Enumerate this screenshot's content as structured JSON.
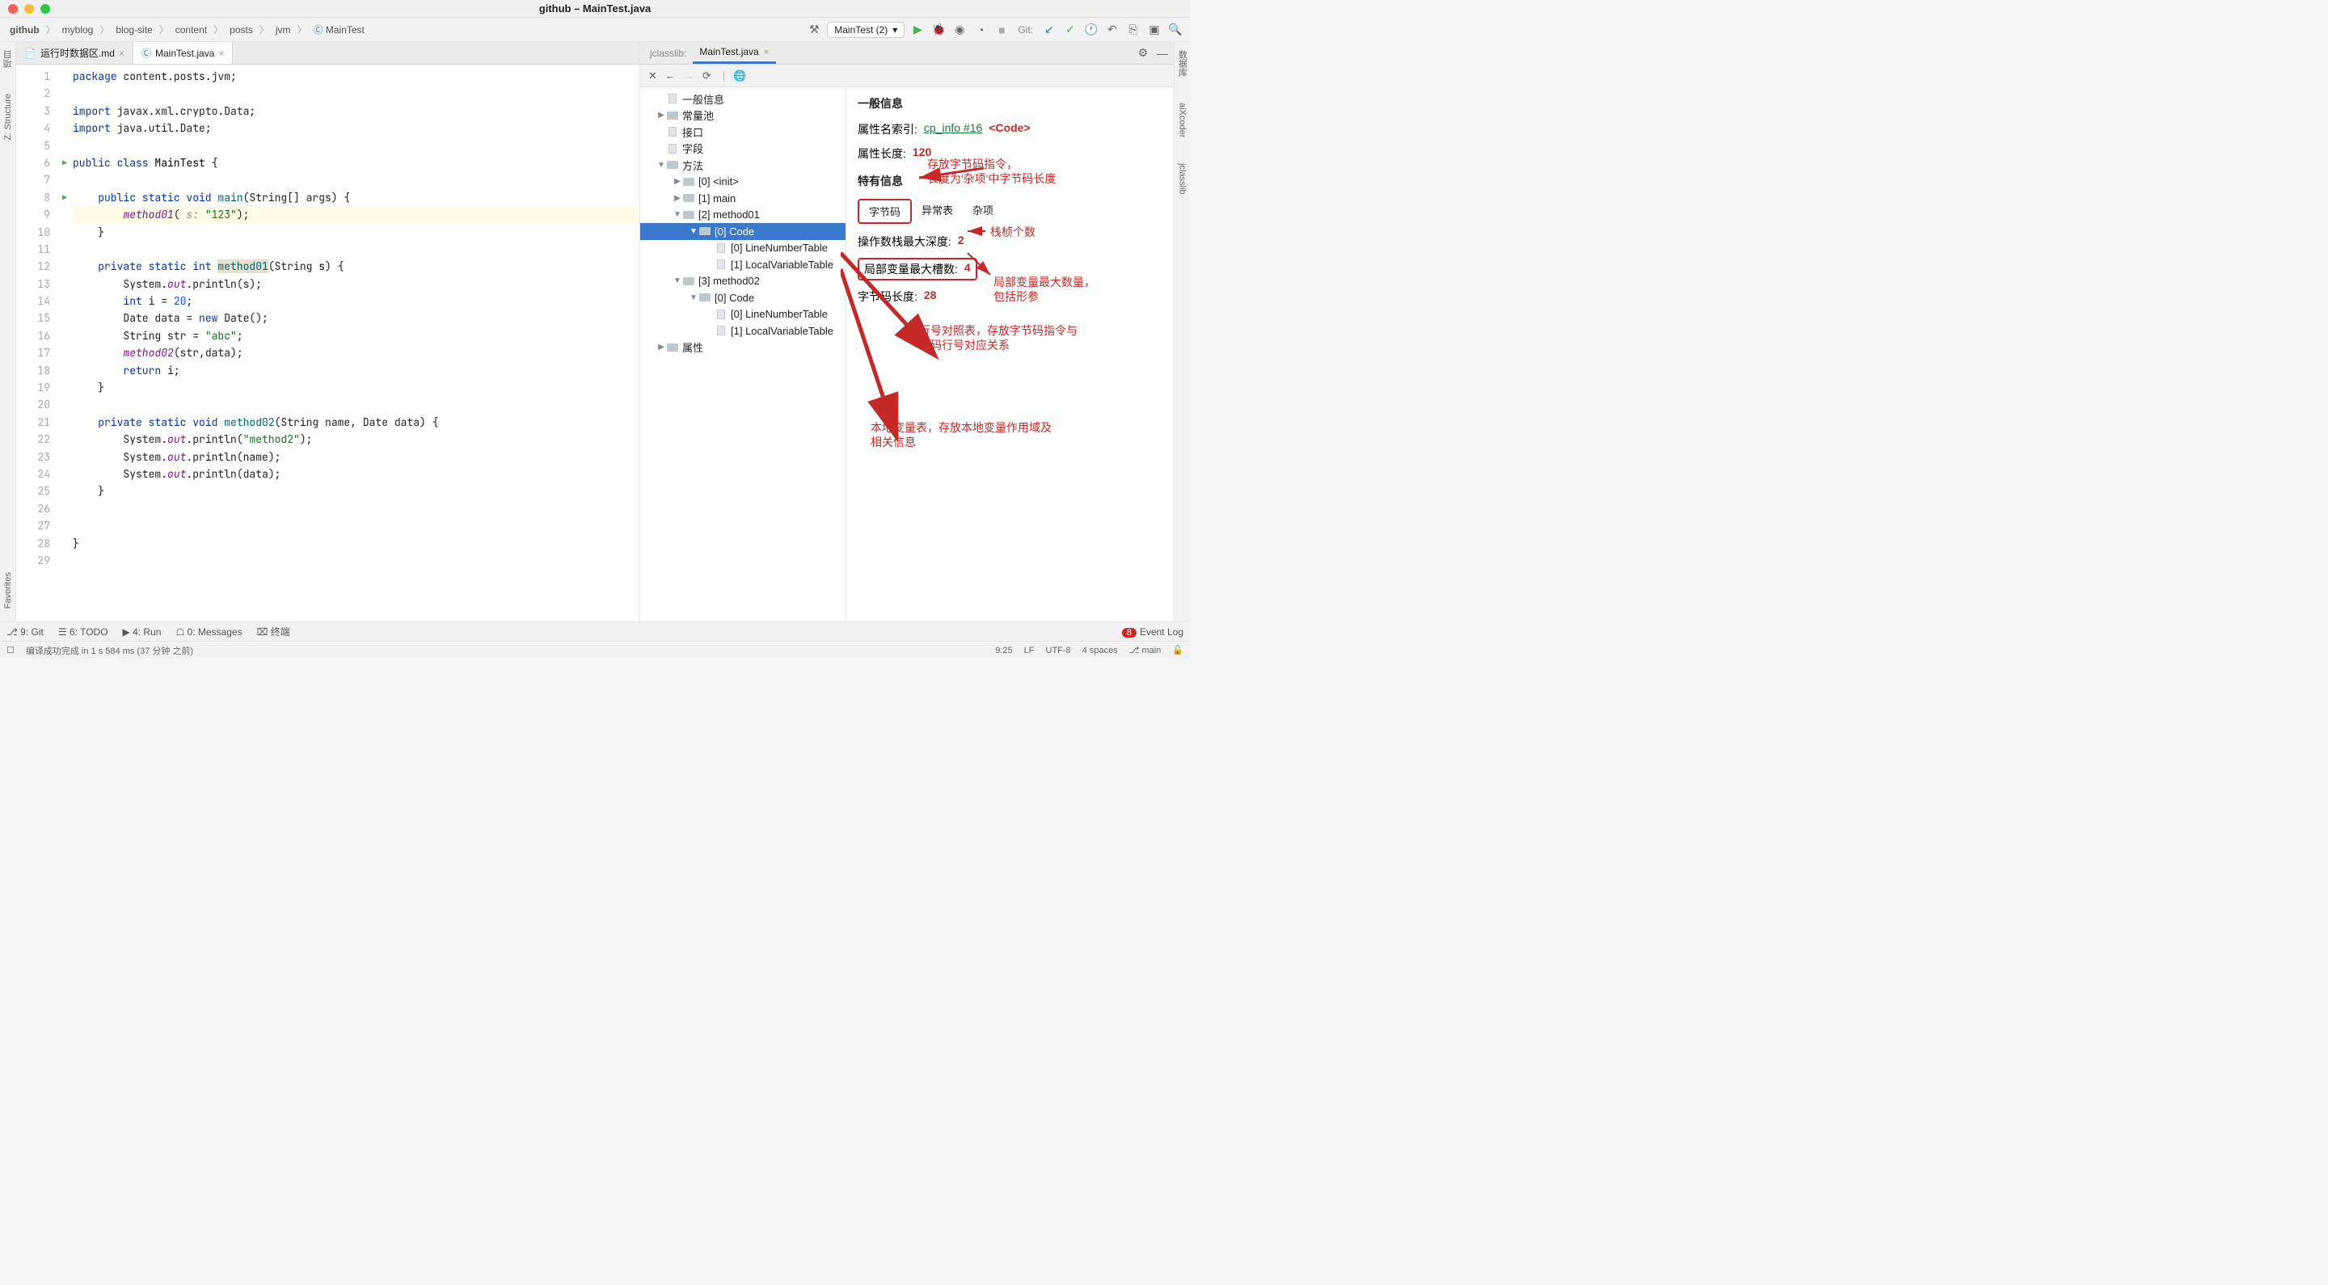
{
  "window_title": "github – MainTest.java",
  "breadcrumbs": [
    "github",
    "myblog",
    "blog-site",
    "content",
    "posts",
    "jvm",
    "MainTest"
  ],
  "run_config": "MainTest (2)",
  "git_label": "Git:",
  "editor_tabs": [
    {
      "label": "运行时数据区.md",
      "active": false,
      "icon": "md"
    },
    {
      "label": "MainTest.java",
      "active": true,
      "icon": "java"
    }
  ],
  "code_lines": [
    {
      "n": 1,
      "segs": [
        [
          "kw",
          "package"
        ],
        [
          "",
          " content.posts.jvm;"
        ]
      ]
    },
    {
      "n": 2,
      "segs": []
    },
    {
      "n": 3,
      "segs": [
        [
          "kw",
          "import"
        ],
        [
          "",
          " javax.xml.crypto.Data;"
        ]
      ]
    },
    {
      "n": 4,
      "segs": [
        [
          "kw",
          "import"
        ],
        [
          "",
          " java.util.Date;"
        ]
      ]
    },
    {
      "n": 5,
      "segs": []
    },
    {
      "n": 6,
      "marker": "▶",
      "segs": [
        [
          "kw",
          "public class "
        ],
        [
          "cls",
          "MainTest"
        ],
        [
          "",
          " {"
        ]
      ]
    },
    {
      "n": 7,
      "segs": []
    },
    {
      "n": 8,
      "marker": "▶",
      "segs": [
        [
          "",
          "    "
        ],
        [
          "kw",
          "public static void "
        ],
        [
          "mthdef",
          "main"
        ],
        [
          "",
          "(String[] args) {"
        ]
      ]
    },
    {
      "n": 9,
      "hl": true,
      "segs": [
        [
          "",
          "        "
        ],
        [
          "fld",
          "method01"
        ],
        [
          "",
          "( "
        ],
        [
          "comment",
          "s: "
        ],
        [
          "str",
          "\"123\""
        ],
        [
          "",
          ");"
        ]
      ]
    },
    {
      "n": 10,
      "segs": [
        [
          "",
          "    }"
        ]
      ]
    },
    {
      "n": 11,
      "segs": []
    },
    {
      "n": 12,
      "segs": [
        [
          "",
          "    "
        ],
        [
          "kw",
          "private static int "
        ],
        [
          "mthdef hl",
          "method01"
        ],
        [
          "",
          "(String "
        ],
        [
          "param",
          "s"
        ],
        [
          "",
          ") {"
        ]
      ]
    },
    {
      "n": 13,
      "segs": [
        [
          "",
          "        System."
        ],
        [
          "fld",
          "out"
        ],
        [
          "",
          ".println(s);"
        ]
      ]
    },
    {
      "n": 14,
      "segs": [
        [
          "",
          "        "
        ],
        [
          "kw",
          "int"
        ],
        [
          "",
          " i = "
        ],
        [
          "num",
          "20"
        ],
        [
          "",
          ";"
        ]
      ]
    },
    {
      "n": 15,
      "segs": [
        [
          "",
          "        Date data = "
        ],
        [
          "kw",
          "new"
        ],
        [
          "",
          " Date();"
        ]
      ]
    },
    {
      "n": 16,
      "segs": [
        [
          "",
          "        String str = "
        ],
        [
          "str",
          "\"abc\""
        ],
        [
          "",
          ";"
        ]
      ]
    },
    {
      "n": 17,
      "segs": [
        [
          "",
          "        "
        ],
        [
          "fld",
          "method02"
        ],
        [
          "",
          "(str,data);"
        ]
      ]
    },
    {
      "n": 18,
      "segs": [
        [
          "",
          "        "
        ],
        [
          "kw",
          "return"
        ],
        [
          "",
          " i;"
        ]
      ]
    },
    {
      "n": 19,
      "segs": [
        [
          "",
          "    }"
        ]
      ]
    },
    {
      "n": 20,
      "segs": []
    },
    {
      "n": 21,
      "segs": [
        [
          "",
          "    "
        ],
        [
          "kw",
          "private static void "
        ],
        [
          "mthdef",
          "method02"
        ],
        [
          "",
          "(String name, Date data) {"
        ]
      ]
    },
    {
      "n": 22,
      "segs": [
        [
          "",
          "        System."
        ],
        [
          "fld",
          "out"
        ],
        [
          "",
          ".println("
        ],
        [
          "str",
          "\"method2\""
        ],
        [
          "",
          ");"
        ]
      ]
    },
    {
      "n": 23,
      "segs": [
        [
          "",
          "        System."
        ],
        [
          "fld",
          "out"
        ],
        [
          "",
          ".println(name);"
        ]
      ]
    },
    {
      "n": 24,
      "segs": [
        [
          "",
          "        System."
        ],
        [
          "fld",
          "out"
        ],
        [
          "",
          ".println(data);"
        ]
      ]
    },
    {
      "n": 25,
      "segs": [
        [
          "",
          "    }"
        ]
      ]
    },
    {
      "n": 26,
      "segs": []
    },
    {
      "n": 27,
      "segs": []
    },
    {
      "n": 28,
      "segs": [
        [
          "",
          "}"
        ]
      ]
    },
    {
      "n": 29,
      "segs": []
    }
  ],
  "jclasslib_label": "jclasslib:",
  "jclasslib_tab": "MainTest.java",
  "jtree": [
    {
      "pad": 20,
      "arrow": "",
      "icon": "file",
      "label": "一般信息"
    },
    {
      "pad": 20,
      "arrow": "▶",
      "icon": "folder",
      "label": "常量池"
    },
    {
      "pad": 20,
      "arrow": "",
      "icon": "file",
      "label": "接口"
    },
    {
      "pad": 20,
      "arrow": "",
      "icon": "file",
      "label": "字段"
    },
    {
      "pad": 20,
      "arrow": "▼",
      "icon": "folder",
      "label": "方法"
    },
    {
      "pad": 40,
      "arrow": "▶",
      "icon": "folder",
      "label": "[0] <init>"
    },
    {
      "pad": 40,
      "arrow": "▶",
      "icon": "folder",
      "label": "[1] main"
    },
    {
      "pad": 40,
      "arrow": "▼",
      "icon": "folder",
      "label": "[2] method01"
    },
    {
      "pad": 60,
      "arrow": "▼",
      "icon": "folder",
      "label": "[0] Code",
      "sel": true
    },
    {
      "pad": 80,
      "arrow": "",
      "icon": "file",
      "label": "[0] LineNumberTable"
    },
    {
      "pad": 80,
      "arrow": "",
      "icon": "file",
      "label": "[1] LocalVariableTable"
    },
    {
      "pad": 40,
      "arrow": "▼",
      "icon": "folder",
      "label": "[3] method02"
    },
    {
      "pad": 60,
      "arrow": "▼",
      "icon": "folder",
      "label": "[0] Code"
    },
    {
      "pad": 80,
      "arrow": "",
      "icon": "file",
      "label": "[0] LineNumberTable"
    },
    {
      "pad": 80,
      "arrow": "",
      "icon": "file",
      "label": "[1] LocalVariableTable"
    },
    {
      "pad": 20,
      "arrow": "▶",
      "icon": "folder",
      "label": "属性"
    }
  ],
  "detail": {
    "section1": "一般信息",
    "attr_name_label": "属性名索引:",
    "attr_name_link": "cp_info #16",
    "attr_name_extra": "<Code>",
    "attr_len_label": "属性长度:",
    "attr_len_val": "120",
    "section2": "特有信息",
    "tabs2": [
      "字节码",
      "异常表",
      "杂项"
    ],
    "max_stack_label": "操作数栈最大深度:",
    "max_stack_val": "2",
    "max_locals_label": "局部变量最大槽数:",
    "max_locals_val": "4",
    "code_len_label": "字节码长度:",
    "code_len_val": "28"
  },
  "annotations": {
    "a1": "存放字节码指令，\n长度为'杂项'中字节码长度",
    "a2": "栈桢个数",
    "a3": "局部变量最大数量，\n包括形参",
    "a4": "行号对照表，存放字节码指令与\n代码行号对应关系",
    "a5": "本地变量表，存放本地变量作用域及\n相关信息"
  },
  "left_tools": [
    "项目",
    "Z: Structure",
    "Favorites"
  ],
  "right_tools": [
    "数据库",
    "aiXcoder",
    "jclasslib"
  ],
  "bottom_tools": {
    "git": "9: Git",
    "todo": "6: TODO",
    "run": "4: Run",
    "messages": "0: Messages",
    "terminal": "终端",
    "event_log": "Event Log",
    "event_badge": "8"
  },
  "statusbar": {
    "msg": "编译成功完成 in 1 s 584 ms (37 分钟 之前)",
    "pos": "9:25",
    "lf": "LF",
    "enc": "UTF-8",
    "indent": "4 spaces",
    "branch": "main"
  }
}
